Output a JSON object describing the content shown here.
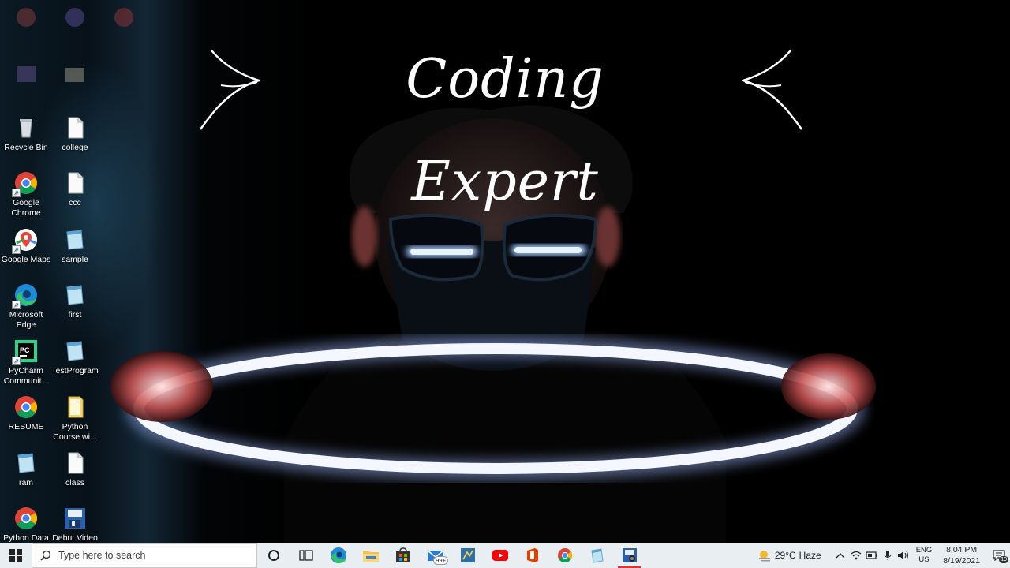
{
  "wallpaper": {
    "title": "Coding Expert"
  },
  "desktop_icons": [
    {
      "label": "",
      "icon": "blurred-app-icon",
      "faded": true
    },
    {
      "label": "",
      "icon": "blurred-app-icon",
      "faded": true
    },
    {
      "label": "",
      "icon": "blurred-app-icon",
      "faded": true
    },
    {
      "label": "",
      "icon": "blurred-app-icon",
      "faded": true
    },
    {
      "label": "",
      "icon": "blurred-app-icon",
      "faded": true
    },
    {
      "label": "Recycle Bin",
      "icon": "recycle-bin-icon"
    },
    {
      "label": "college",
      "icon": "document-icon"
    },
    {
      "label": "Google Chrome",
      "icon": "chrome-icon"
    },
    {
      "label": "ccc",
      "icon": "document-icon"
    },
    {
      "label": "Google Maps",
      "icon": "maps-icon"
    },
    {
      "label": "sample",
      "icon": "notepad-icon"
    },
    {
      "label": "Microsoft Edge",
      "icon": "edge-icon"
    },
    {
      "label": "first",
      "icon": "notepad-icon"
    },
    {
      "label": "PyCharm Communit...",
      "icon": "pycharm-icon"
    },
    {
      "label": "TestProgram",
      "icon": "notepad-icon"
    },
    {
      "label": "RESUME",
      "icon": "chrome-icon"
    },
    {
      "label": "Python Course wi...",
      "icon": "folder-icon"
    },
    {
      "label": "ram",
      "icon": "notepad-icon"
    },
    {
      "label": "class",
      "icon": "document-icon"
    },
    {
      "label": "Python Data",
      "icon": "chrome-icon"
    },
    {
      "label": "Debut Video",
      "icon": "debut-video-icon"
    }
  ],
  "taskbar": {
    "search_placeholder": "Type here to search",
    "mail_badge": "99+",
    "apps": [
      {
        "name": "cortana-icon"
      },
      {
        "name": "task-view-icon"
      },
      {
        "name": "edge-icon"
      },
      {
        "name": "file-explorer-icon"
      },
      {
        "name": "store-icon"
      },
      {
        "name": "mail-icon"
      },
      {
        "name": "python-idle-icon"
      },
      {
        "name": "youtube-icon"
      },
      {
        "name": "office-icon"
      },
      {
        "name": "chrome-icon"
      },
      {
        "name": "notepad-icon"
      },
      {
        "name": "debut-video-icon"
      }
    ],
    "tray": {
      "weather_temp": "29°C",
      "weather_desc": "Haze",
      "lang_line1": "ENG",
      "lang_line2": "US",
      "time": "8:04 PM",
      "date": "8/19/2021",
      "notif_count": "19"
    },
    "colors": {
      "taskbar_bg": "#e9eef3",
      "active_indicator": "#dd3333"
    }
  }
}
